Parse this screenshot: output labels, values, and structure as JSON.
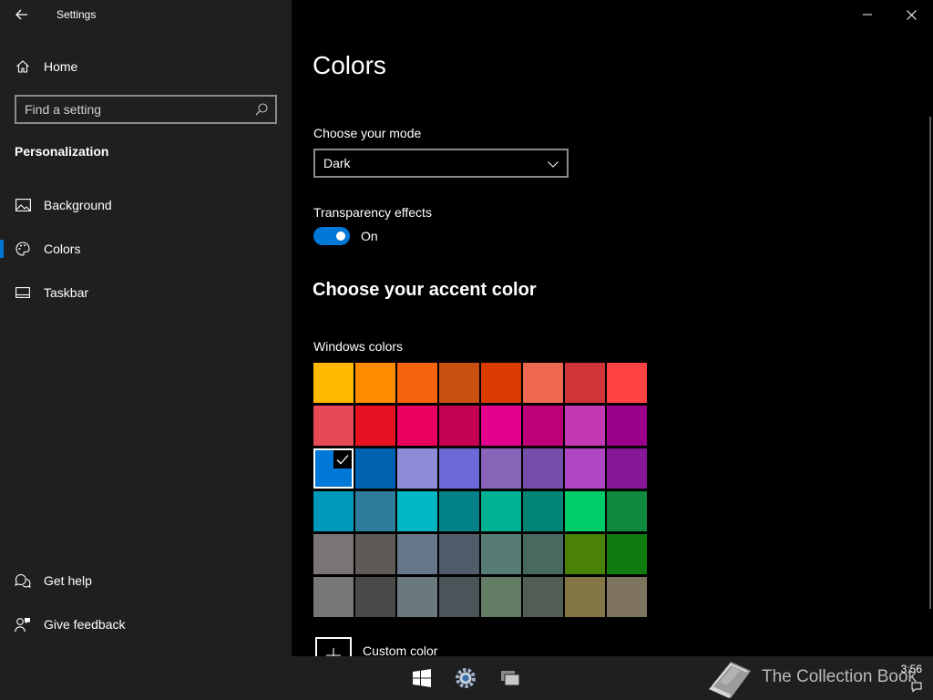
{
  "window": {
    "title": "Settings"
  },
  "sidebar": {
    "home_label": "Home",
    "search_placeholder": "Find a setting",
    "section": "Personalization",
    "items": [
      {
        "label": "Background",
        "icon": "picture-icon"
      },
      {
        "label": "Colors",
        "icon": "palette-icon",
        "active": true
      },
      {
        "label": "Taskbar",
        "icon": "taskbar-icon"
      }
    ],
    "bottom": [
      {
        "label": "Get help",
        "icon": "help-chat-icon"
      },
      {
        "label": "Give feedback",
        "icon": "feedback-icon"
      }
    ]
  },
  "main": {
    "title": "Colors",
    "mode_label": "Choose your mode",
    "mode_value": "Dark",
    "transparency_label": "Transparency effects",
    "transparency_state": "On",
    "accent_heading": "Choose your accent color",
    "windows_colors_label": "Windows colors",
    "custom_color_label": "Custom color",
    "accent_colors": [
      [
        "#ffb900",
        "#ff8c00",
        "#f7630c",
        "#ca5010",
        "#da3b01",
        "#ef6950",
        "#d13438",
        "#ff4343"
      ],
      [
        "#e74856",
        "#e81123",
        "#ea005e",
        "#c30052",
        "#e3008c",
        "#bf0077",
        "#c239b3",
        "#9a0089"
      ],
      [
        "#0078d7",
        "#0063b1",
        "#8e8cd8",
        "#6b69d6",
        "#8764b8",
        "#744da9",
        "#b146c2",
        "#881798"
      ],
      [
        "#0099bc",
        "#2d7d9a",
        "#00b7c3",
        "#038387",
        "#00b294",
        "#018574",
        "#00cc6a",
        "#10893e"
      ],
      [
        "#7a7574",
        "#5d5a58",
        "#68768a",
        "#515c6b",
        "#567c73",
        "#486860",
        "#498205",
        "#107c10"
      ],
      [
        "#767676",
        "#4c4a48",
        "#69797e",
        "#4a5459",
        "#647c64",
        "#525e54",
        "#847545",
        "#7e735f"
      ]
    ],
    "selected_color": "#0078d7"
  },
  "taskbar": {
    "watermark": "The Collection Book",
    "time": "3:56"
  }
}
